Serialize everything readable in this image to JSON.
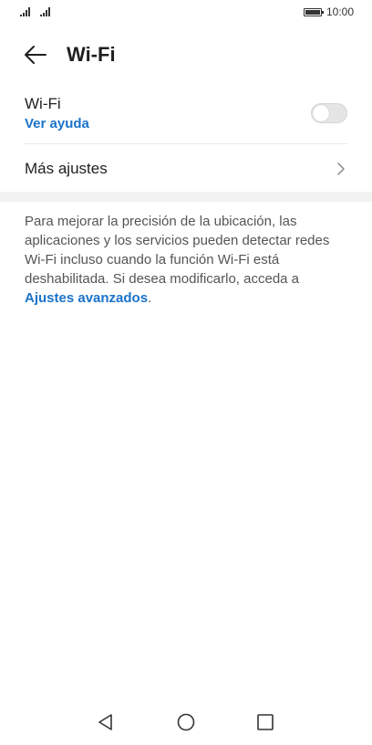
{
  "status_bar": {
    "time": "10:00",
    "battery_icon": "battery-full-icon",
    "signal_icons": [
      "signal-icon",
      "signal-icon"
    ]
  },
  "header": {
    "title": "Wi-Fi",
    "back_icon": "arrow-left-icon"
  },
  "wifi_setting": {
    "label": "Wi-Fi",
    "help_link": "Ver ayuda",
    "toggle_on": false
  },
  "more_settings": {
    "label": "Más ajustes",
    "icon": "chevron-right-icon"
  },
  "info": {
    "text": "Para mejorar la precisión de la ubicación, las aplicaciones y los servicios pueden detectar redes Wi-Fi incluso cuando la función Wi-Fi está deshabilitada. Si desea modificarlo, acceda a ",
    "link": "Ajustes avanzados",
    "suffix": "."
  },
  "nav_bar": {
    "back_icon": "triangle-back-icon",
    "home_icon": "circle-home-icon",
    "recent_icon": "square-recent-icon"
  },
  "colors": {
    "accent": "#1a73c9",
    "text": "#1f1f1f",
    "secondary_text": "#555555",
    "divider": "#e6e6e6",
    "toggle_off": "#e5e5e5"
  }
}
